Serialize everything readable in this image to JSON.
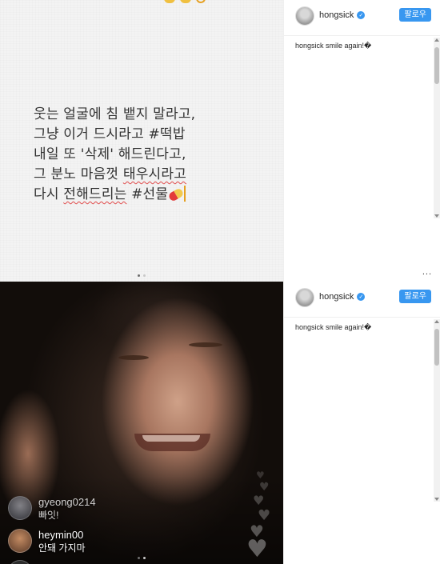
{
  "caption_image": {
    "lines": [
      [
        "웃는 얼굴에 침 뱉지 말라고,"
      ],
      [
        "그냥 이거 드시라고 #떡밥"
      ],
      [
        "내일 또 '삭제' 해드린다고,"
      ],
      [
        "그 분노 마음껏 ",
        "태우시라고"
      ],
      [
        "다시 ",
        "전해드리는",
        " #선물"
      ]
    ]
  },
  "posts": [
    {
      "username": "hongsick",
      "follow_label": "팔로우",
      "caption_user": "hongsick",
      "caption_text": " smile again!�",
      "more_label": "..."
    },
    {
      "username": "hongsick",
      "follow_label": "팔로우",
      "caption_user": "hongsick",
      "caption_text": " smile again!�",
      "more_label": "..."
    }
  ],
  "live_comments": [
    {
      "user": "gyeong0214",
      "text": "빠잇!"
    },
    {
      "user": "heymin00",
      "text": "안돼 가지마"
    },
    {
      "user": "",
      "text": ""
    }
  ],
  "colors": {
    "follow_button": "#3897f0",
    "verified_badge": "#3897f0",
    "spellcheck_underline": "#e04a4a"
  },
  "icons": {
    "verified": "verified-badge-icon",
    "pill": "pill-emoji-icon",
    "hearts": "heart-icon"
  }
}
